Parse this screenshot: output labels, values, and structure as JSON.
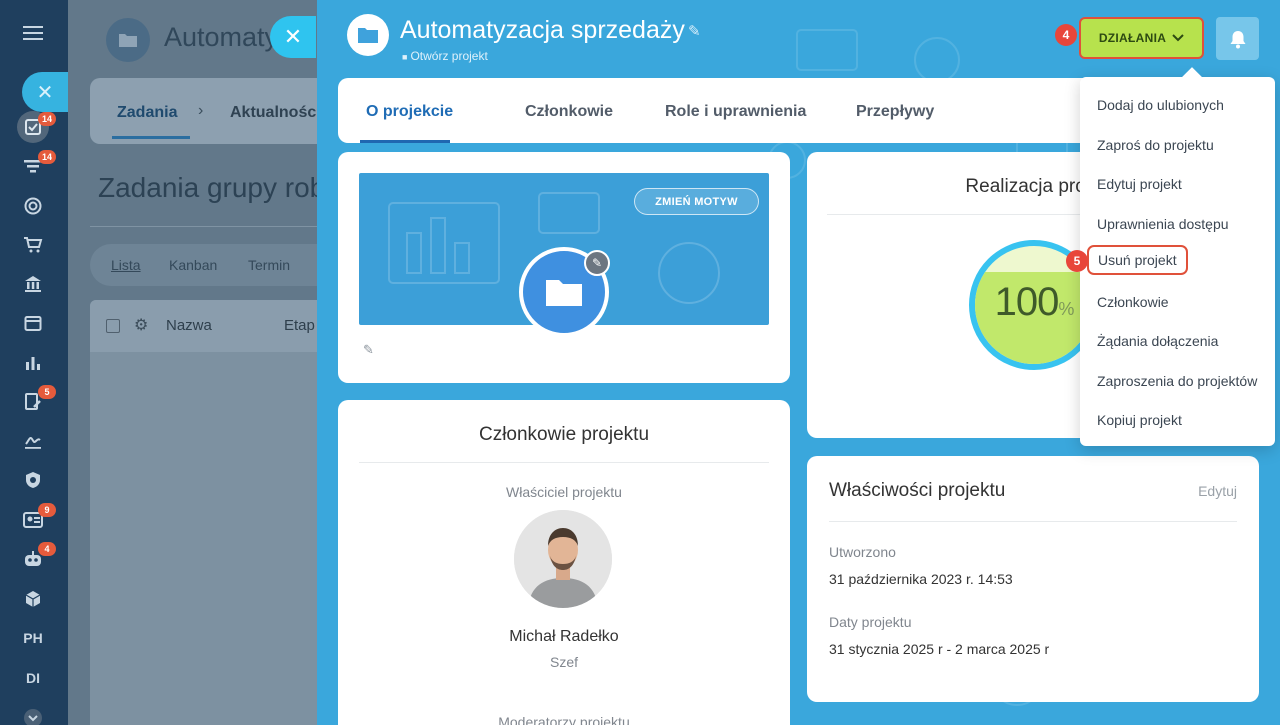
{
  "sidebar": {
    "badges": [
      "14",
      "14",
      "5",
      "9",
      "4"
    ],
    "text_items": [
      "PH",
      "DI"
    ]
  },
  "background": {
    "title": "Automaty",
    "tabs": [
      "Zadania",
      "Aktualności"
    ],
    "heading": "Zadania grupy rob",
    "views": [
      "Lista",
      "Kanban",
      "Termin"
    ],
    "columns": [
      "Nazwa",
      "Etap"
    ]
  },
  "project": {
    "title": "Automatyzacja sprzedaży",
    "subtitle": "Otwórz projekt"
  },
  "header": {
    "actions_label": "DZIAŁANIA",
    "step_4": "4",
    "step_5": "5"
  },
  "tabs": [
    {
      "label": "O projekcie",
      "active": true
    },
    {
      "label": "Członkowie",
      "active": false
    },
    {
      "label": "Role i uprawnienia",
      "active": false
    },
    {
      "label": "Przepływy",
      "active": false
    }
  ],
  "theme_card": {
    "change_theme_label": "ZMIEŃ MOTYW"
  },
  "progress_card": {
    "title": "Realizacja proje",
    "percent": "100",
    "percent_sign": "%",
    "progress_fraction": 1.0
  },
  "members_card": {
    "title": "Członkowie projektu",
    "owner_label": "Właściciel projektu",
    "owner_name": "Michał Radełko",
    "owner_role": "Szef",
    "moderators_label": "Moderatorzy projektu"
  },
  "properties_card": {
    "title": "Właściwości projektu",
    "edit_label": "Edytuj",
    "created_label": "Utworzono",
    "created_value": "31 października 2023 r. 14:53",
    "dates_label": "Daty projektu",
    "dates_value": "31 stycznia 2025 r - 2 marca 2025 r"
  },
  "menu": {
    "items": [
      "Dodaj do ulubionych",
      "Zaproś do projektu",
      "Edytuj projekt",
      "Uprawnienia dostępu",
      "Usuń projekt",
      "Członkowie",
      "Żądania dołączenia",
      "Zaproszenia do projektów",
      "Kopiuj projekt"
    ],
    "highlighted_index": 4
  },
  "colors": {
    "accent_green": "#b7e24d",
    "highlight_red": "#e0513a",
    "tab_active_blue": "#1f6cb5",
    "slider_blue": "#3aa7dc"
  }
}
